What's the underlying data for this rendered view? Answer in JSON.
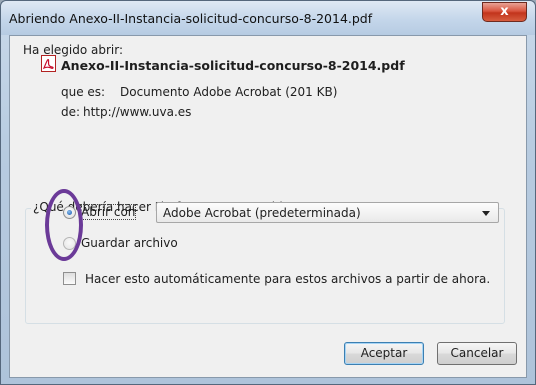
{
  "dialog": {
    "title": "Abriendo Anexo-II-Instancia-solicitud-concurso-8-2014.pdf",
    "close_label": "x"
  },
  "intro": "Ha elegido abrir:",
  "file": {
    "icon": "pdf-icon",
    "name": "Anexo-II-Instancia-solicitud-concurso-8-2014.pdf",
    "type_label": "que es:",
    "type_value": "Documento Adobe Acrobat (201 KB)",
    "from_label": "de:",
    "from_value": "http://www.uva.es"
  },
  "question": "¿Qué debería hacer Firefox con este archivo?",
  "options": {
    "open_with_label": "Abrir con",
    "open_with_checked": true,
    "open_with_app": "Adobe Acrobat  (predeterminada)",
    "save_label": "Guardar archivo",
    "save_checked": false
  },
  "auto_checkbox": {
    "label": "Hacer esto automáticamente para estos archivos a partir de ahora.",
    "checked": false
  },
  "buttons": {
    "accept": "Aceptar",
    "cancel": "Cancelar"
  },
  "colors": {
    "annotation_circle": "#6b3a98",
    "close_button": "#c2341c"
  }
}
